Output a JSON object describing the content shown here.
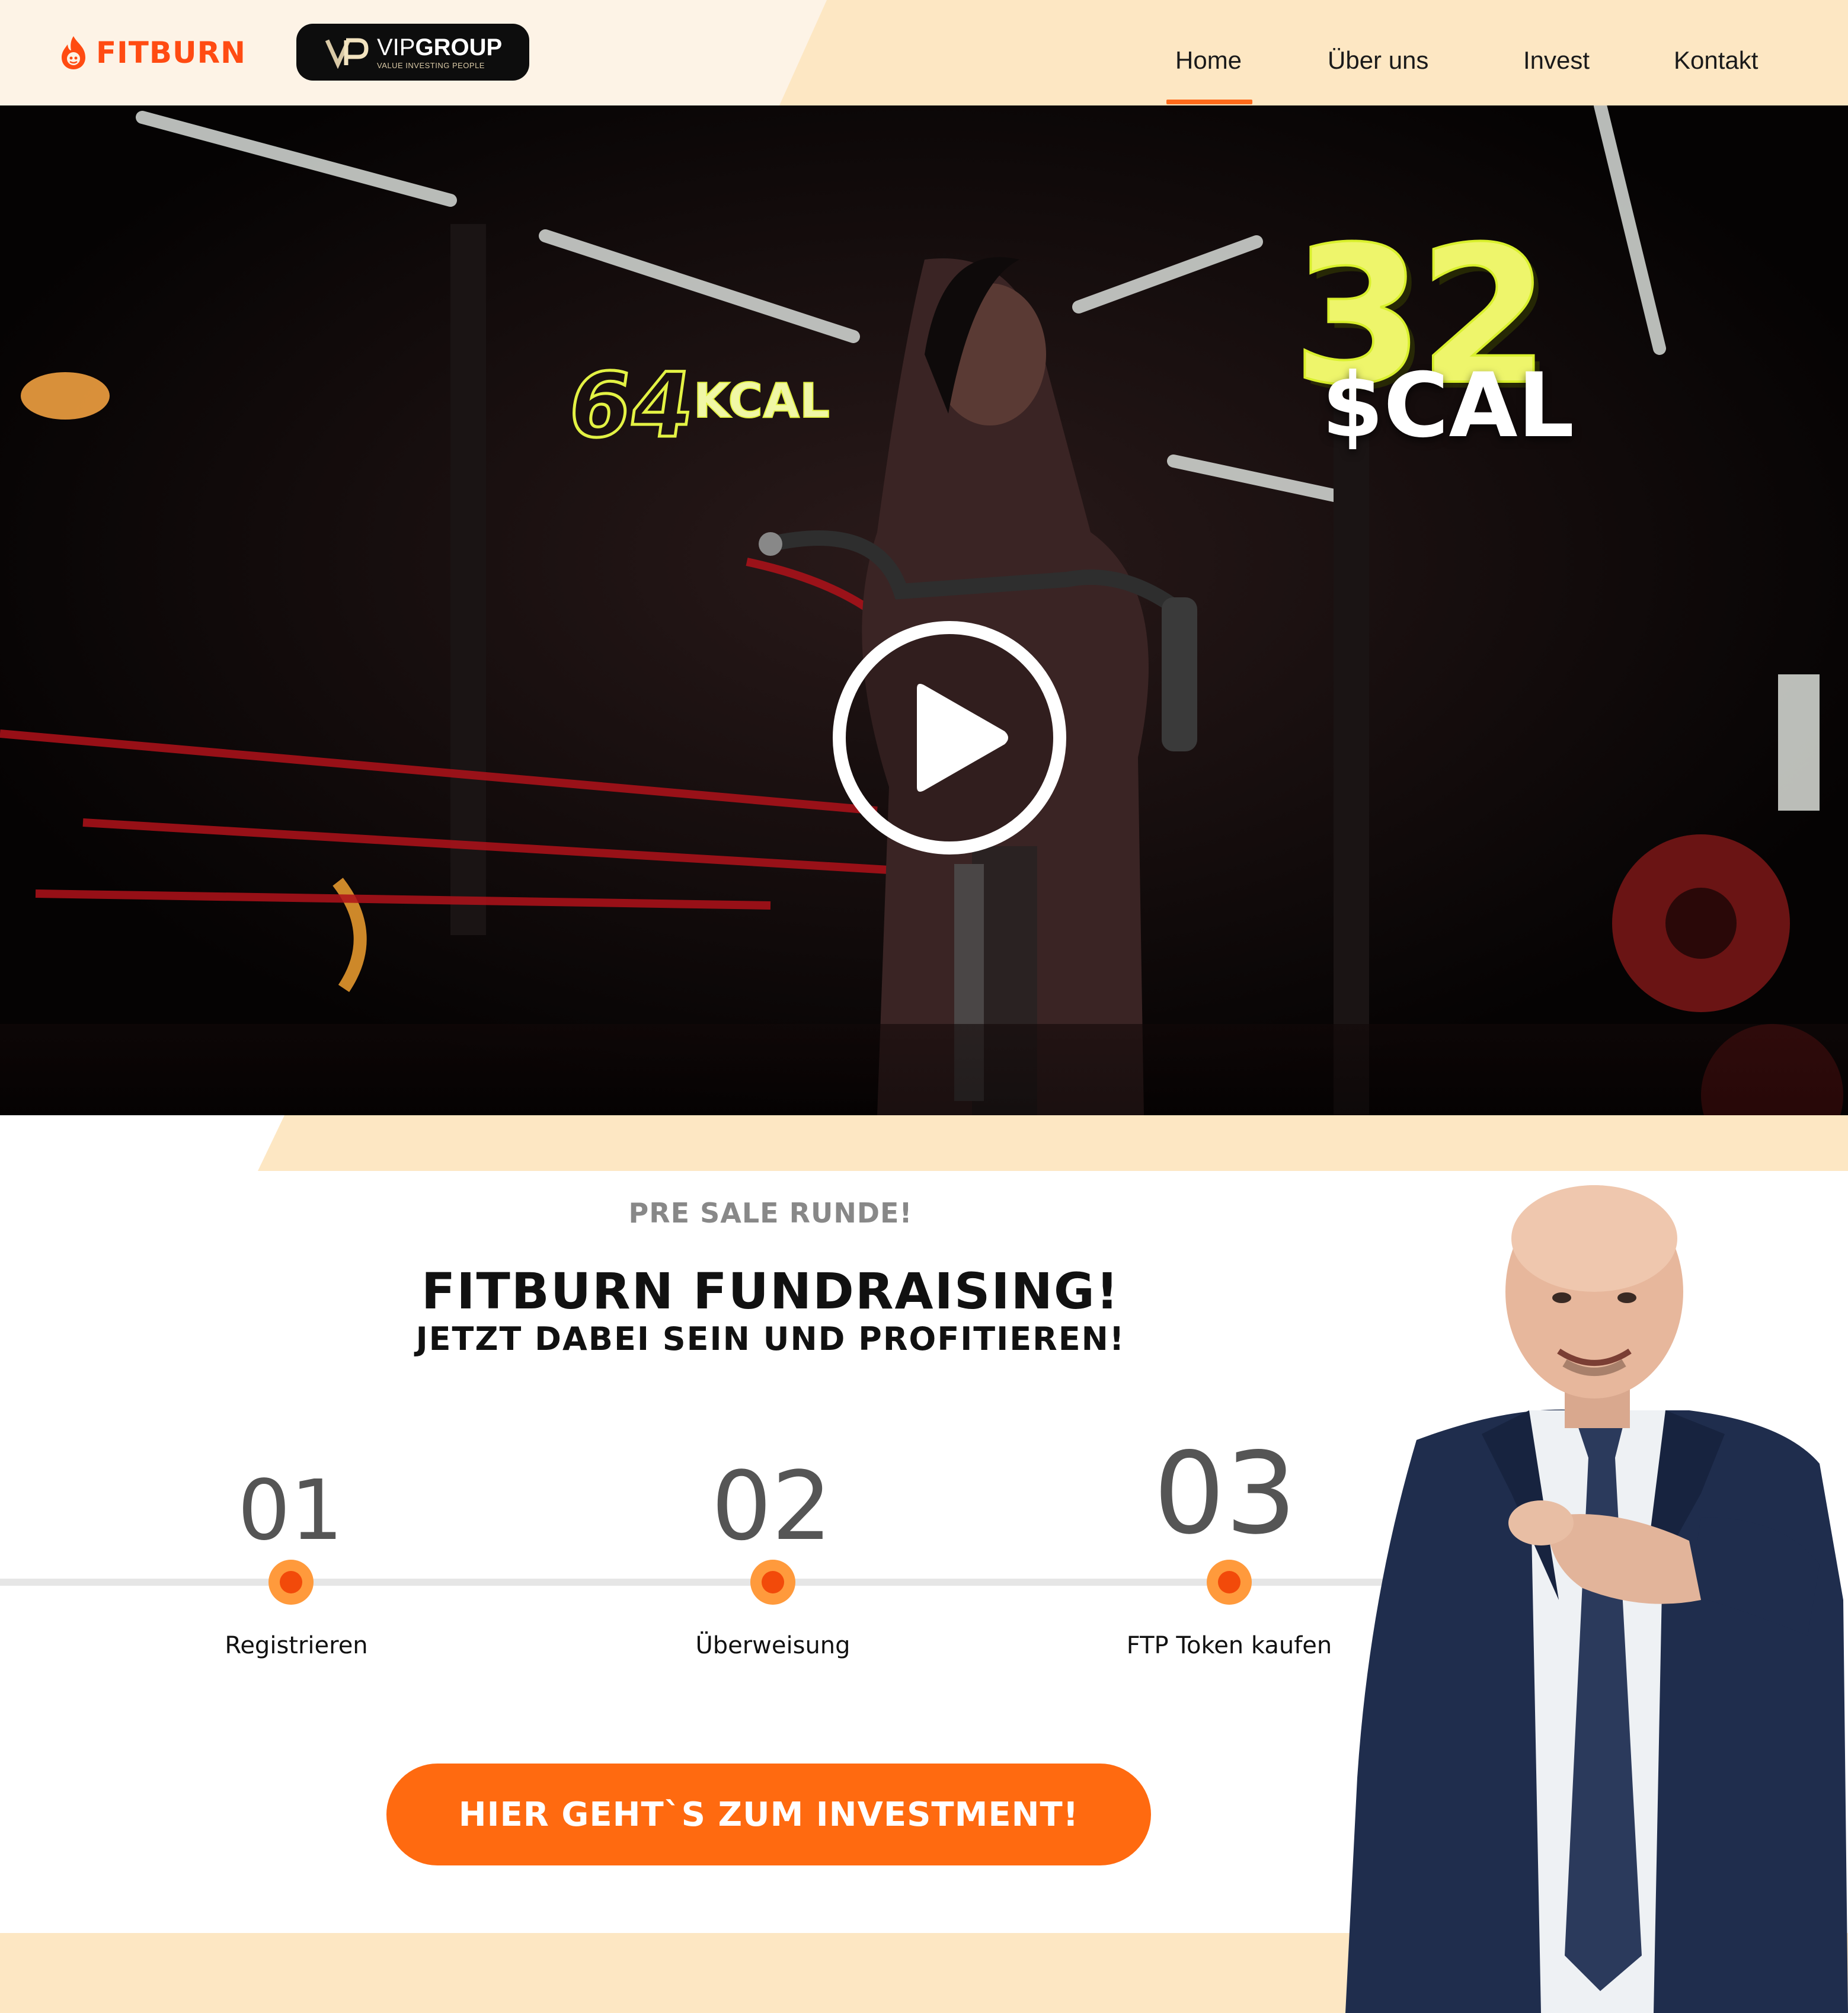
{
  "header": {
    "brand_name": "FITBURN",
    "partner_logo": {
      "main_thin": "VIP",
      "main_bold": "GROUP",
      "sub": "VALUE INVESTING PEOPLE"
    },
    "nav": [
      {
        "label": "Home",
        "active": true
      },
      {
        "label": "Über uns",
        "active": false
      },
      {
        "label": "Invest",
        "active": false
      },
      {
        "label": "Kontakt",
        "active": false
      }
    ]
  },
  "video": {
    "overlay_kcal_number": "64",
    "overlay_kcal_unit": "KCAL",
    "overlay_cal_number": "32",
    "overlay_cal_unit": "$CAL",
    "play_icon": "play-icon"
  },
  "presale": {
    "eyebrow": "PRE SALE RUNDE!",
    "headline": "FITBURN FUNDRAISING!",
    "subline": "JETZT DABEI SEIN UND PROFITIEREN!",
    "steps": [
      {
        "number": "01",
        "label": "Registrieren"
      },
      {
        "number": "02",
        "label": "Überweisung"
      },
      {
        "number": "03",
        "label": "FTP Token kaufen"
      }
    ],
    "cta_label": "HIER GEHT`S ZUM INVESTMENT!"
  },
  "colors": {
    "accent": "#ff6a10",
    "brand_orange": "#ff4b12",
    "header_bg": "#fdf3e6",
    "band_peach": "#fde7c3",
    "overlay_yellow": "#e3f244"
  }
}
